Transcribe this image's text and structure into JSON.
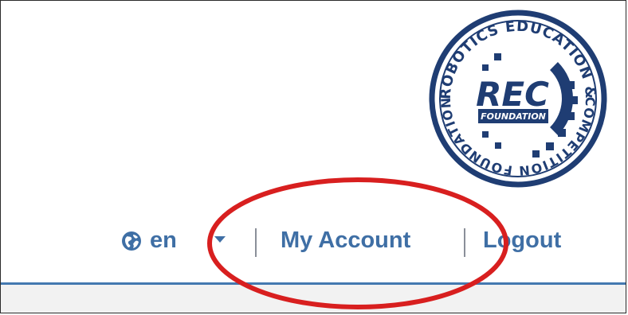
{
  "header": {
    "logo": {
      "name": "rec-foundation-logo",
      "text_top": "ROBOTICS EDUCATION &",
      "text_bottom": "COMPETITION FOUNDATION",
      "center_main": "REC",
      "center_sub": "FOUNDATION"
    }
  },
  "nav": {
    "language": {
      "icon": "globe-icon",
      "value": "en"
    },
    "account_label": "My Account",
    "logout_label": "Logout",
    "separator": "|"
  },
  "colors": {
    "link": "#3f6fa5",
    "logo": "#1f3d73",
    "rule": "#4479b0",
    "annotation": "#d81f1f"
  },
  "annotation": {
    "shape": "ellipse",
    "target": "My Account"
  }
}
